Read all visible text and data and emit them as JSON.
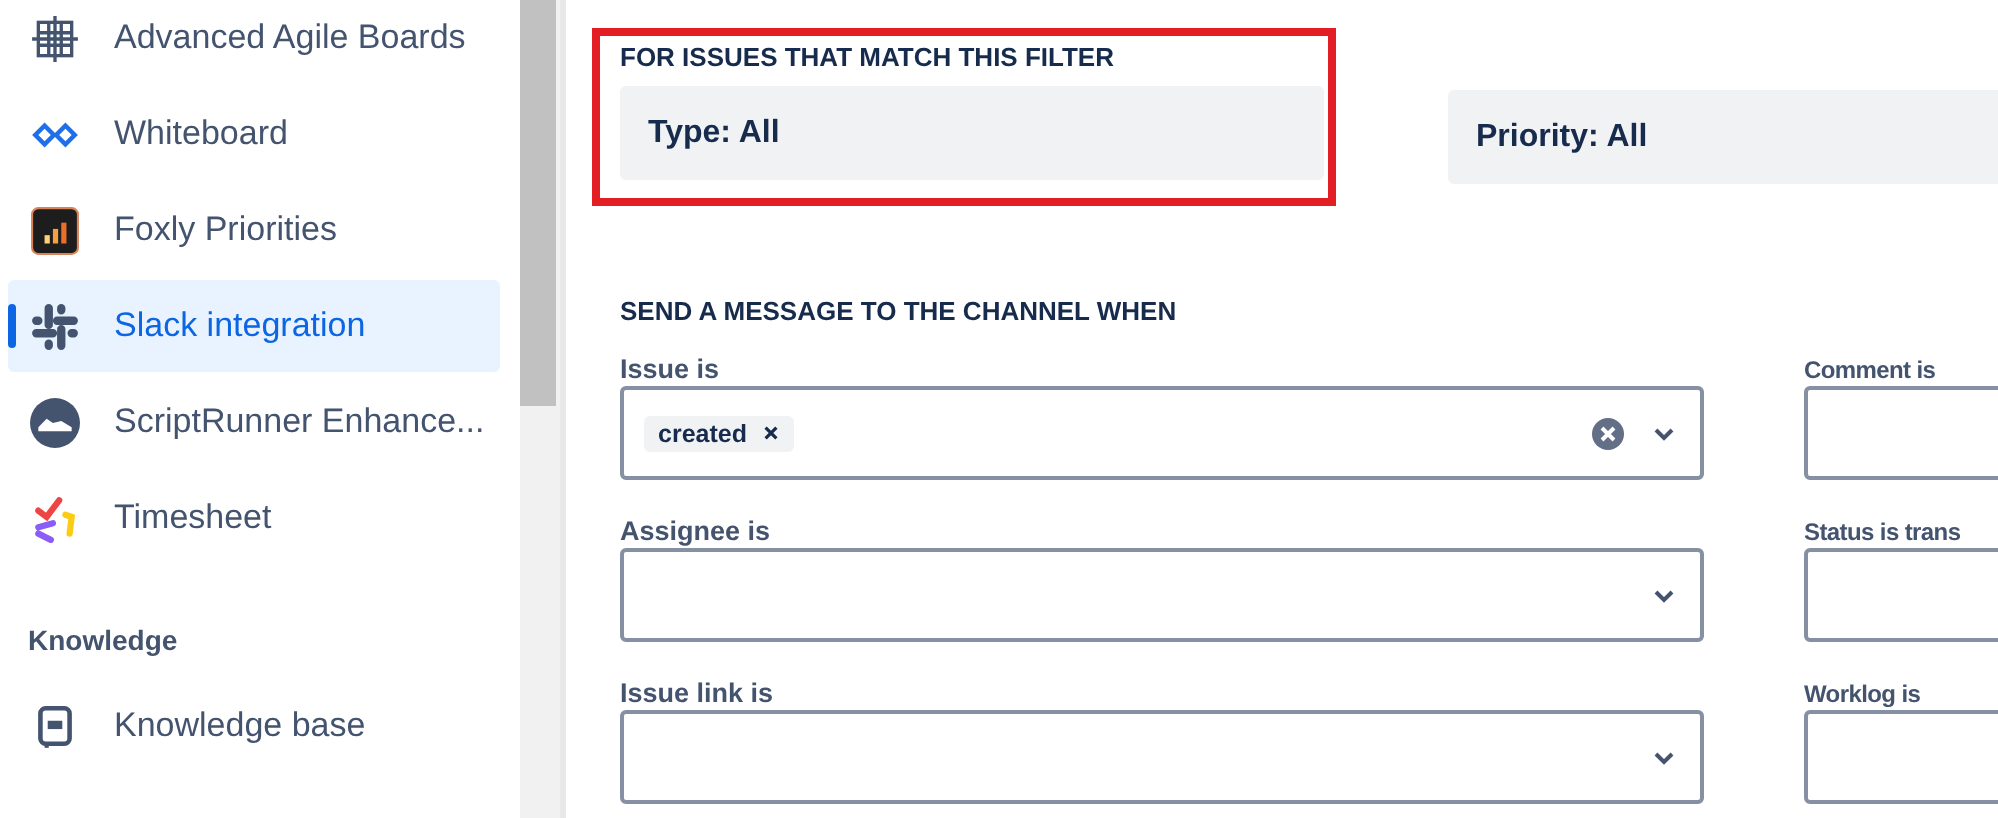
{
  "sidebar": {
    "groups": [
      {
        "items": [
          {
            "label": "Advanced Agile Boards",
            "selected": false
          },
          {
            "label": "Whiteboard",
            "selected": false
          },
          {
            "label": "Foxly Priorities",
            "selected": false
          },
          {
            "label": "Slack integration",
            "selected": true
          },
          {
            "label": "ScriptRunner Enhance...",
            "selected": false
          },
          {
            "label": "Timesheet",
            "selected": false
          }
        ]
      },
      {
        "heading": "Knowledge",
        "items": [
          {
            "label": "Knowledge base",
            "selected": false
          }
        ]
      }
    ]
  },
  "filter": {
    "heading": "FOR ISSUES THAT MATCH THIS FILTER",
    "highlighted": true,
    "type": "Type: All",
    "priority": "Priority: All"
  },
  "triggers": {
    "heading": "SEND A MESSAGE TO THE CHANNEL WHEN",
    "left": [
      {
        "label": "Issue is",
        "chips": [
          "created"
        ],
        "clearable": true
      },
      {
        "label": "Assignee is",
        "clearable": false
      },
      {
        "label": "Issue link is",
        "clearable": false
      }
    ],
    "right": [
      {
        "label": "Comment is"
      },
      {
        "label": "Status is trans"
      },
      {
        "label": "Worklog is"
      }
    ]
  }
}
